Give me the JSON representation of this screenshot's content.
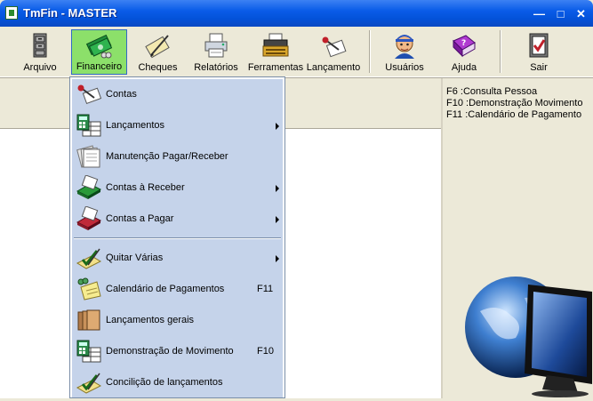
{
  "window": {
    "title": "TmFin - MASTER",
    "controls": [
      "minimize",
      "maximize",
      "close"
    ]
  },
  "toolbar": {
    "buttons": [
      {
        "label": "Arquivo",
        "icon": "file-cabinet-icon"
      },
      {
        "label": "Financeiro",
        "icon": "money-icon",
        "active": true
      },
      {
        "label": "Cheques",
        "icon": "cheque-pen-icon"
      },
      {
        "label": "Relatórios",
        "icon": "printer-icon"
      },
      {
        "label": "Ferramentas",
        "icon": "typewriter-icon"
      },
      {
        "label": "Lançamento",
        "icon": "entry-icon"
      },
      {
        "label": "Usuários",
        "icon": "user-icon"
      },
      {
        "label": "Ajuda",
        "icon": "help-book-icon"
      },
      {
        "label": "Sair",
        "icon": "exit-icon"
      }
    ]
  },
  "menu": {
    "items": [
      {
        "label": "Contas",
        "shortcut": "",
        "submenu": false
      },
      {
        "label": "Lançamentos",
        "shortcut": "",
        "submenu": true
      },
      {
        "label": "Manutenção Pagar/Receber",
        "shortcut": "",
        "submenu": false
      },
      {
        "label": "Contas à Receber",
        "shortcut": "",
        "submenu": true
      },
      {
        "label": "Contas a Pagar",
        "shortcut": "",
        "submenu": true
      },
      {
        "label": "Quitar Várias",
        "shortcut": "",
        "submenu": true
      },
      {
        "label": "Calendário de Pagamentos",
        "shortcut": "F11",
        "submenu": false
      },
      {
        "label": "Lançamentos gerais",
        "shortcut": "",
        "submenu": false
      },
      {
        "label": "Demonstração de Movimento",
        "shortcut": "F10",
        "submenu": false
      },
      {
        "label": "Concilição de lançamentos",
        "shortcut": "",
        "submenu": false
      }
    ]
  },
  "shortcuts_panel": {
    "lines": [
      "F6 :Consulta Pessoa",
      "F10 :Demonstração Movimento",
      "F11 :Calendário de Pagamento"
    ]
  },
  "colors": {
    "title_bar": "#0A5CE8",
    "menu_bg": "#C5D3EA",
    "active_button": "#8CE06A",
    "window_bg": "#ECE9D8"
  }
}
